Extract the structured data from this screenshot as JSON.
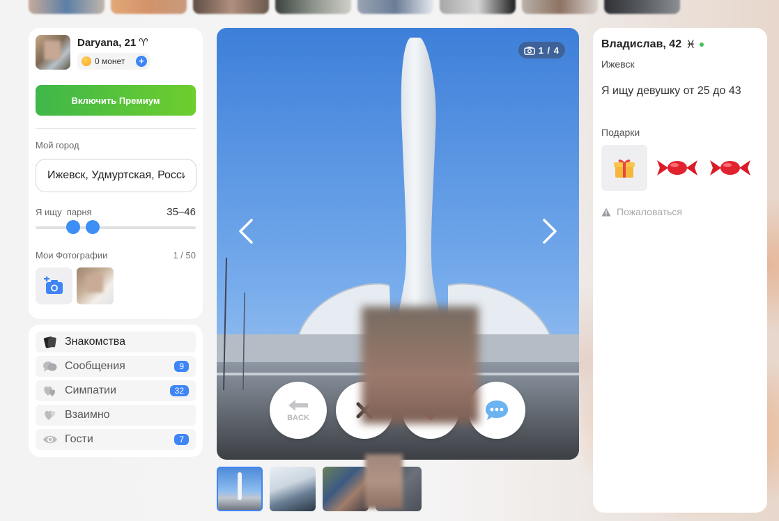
{
  "me": {
    "name": "Daryana, 21",
    "zodiac": "♈",
    "coins_label": "0 монет",
    "premium_label": "Включить Премиум",
    "city_label": "Мой город",
    "city_value": "Ижевск, Удмуртская, Россия",
    "seek_label": "Я ищу  парня",
    "age_range": "35–46",
    "age_min": 35,
    "age_max": 46,
    "photos_label": "Мои Фотографии",
    "photos_count": "1 / 50"
  },
  "nav": {
    "items": [
      {
        "label": "Знакомства",
        "icon": "cards-icon",
        "badge": ""
      },
      {
        "label": "Сообщения",
        "icon": "chat-bubbles-icon",
        "badge": "9"
      },
      {
        "label": "Симпатии",
        "icon": "hearts-icon",
        "badge": "32"
      },
      {
        "label": "Взаимно",
        "icon": "mutual-hearts-icon",
        "badge": ""
      },
      {
        "label": "Гости",
        "icon": "eye-icon",
        "badge": "7"
      }
    ]
  },
  "photo": {
    "counter": "1 / 4",
    "back_label": "BACK"
  },
  "profile": {
    "name": "Владислав, 42",
    "zodiac": "♓",
    "city": "Ижевск",
    "seek": "Я ищу девушку от 25 до 43",
    "gifts_title": "Подарки",
    "report_label": "Пожаловаться"
  },
  "colors": {
    "accent": "#3f85f5",
    "premium_start": "#3fb74a",
    "premium_end": "#6ece2d",
    "online": "#46c15a"
  }
}
